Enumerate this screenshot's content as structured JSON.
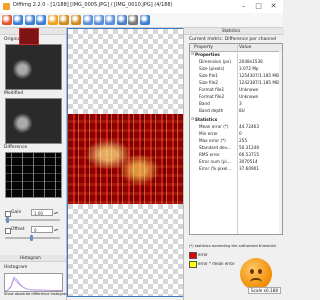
{
  "window": {
    "title": "Diffimg 2.2.0 - [1/188] [IMG_0005.JPG] / [IMG_0010.JPG] (4/188)",
    "controls": [
      "minimize",
      "maximize",
      "close"
    ]
  },
  "toolbar": {
    "buttons": [
      {
        "name": "open-icon",
        "color": "#e4572e"
      },
      {
        "name": "save-icon",
        "color": "#3b7ed3"
      },
      {
        "name": "previous-icon",
        "color": "#3b7ed3"
      },
      {
        "name": "next-icon",
        "color": "#3b7ed3"
      },
      {
        "name": "refresh-icon",
        "color": "#f0a020"
      },
      {
        "name": "flip-icon",
        "color": "#d08a20"
      },
      {
        "name": "layout-icon",
        "color": "#d08a20"
      },
      {
        "name": "zoom-fit-icon",
        "color": "#5a8ed8"
      },
      {
        "name": "zoom-in-icon",
        "color": "#5a8ed8"
      },
      {
        "name": "zoom-out-icon",
        "color": "#5a8ed8"
      },
      {
        "name": "select-icon",
        "color": "#4a7fc8"
      },
      {
        "name": "settings-icon",
        "color": "#777777"
      },
      {
        "name": "help-icon",
        "color": "#3b7ed3"
      }
    ]
  },
  "navigator": {
    "header": "Navigator",
    "original_label": "Original",
    "modified_label": "Modified",
    "difference_label": "Difference",
    "gain": {
      "label": "Gain",
      "value": "1.00"
    },
    "offset": {
      "label": "Offset",
      "value": "0"
    }
  },
  "histogram": {
    "header": "Histogram",
    "label": "Histogram",
    "note": "Show absolute difference histogram"
  },
  "statistics": {
    "header": "Statistics",
    "current_metric": "Current metric: Difference per channel",
    "columns": [
      "Property",
      "Value"
    ],
    "groups": [
      {
        "label": "Properties",
        "rows": [
          {
            "property": "Dimension (px)",
            "value": "2048x1536"
          },
          {
            "property": "Size (pixels)",
            "value": "3.072 Mp"
          },
          {
            "property": "Size file1",
            "value": "1254307/1.185 MB"
          },
          {
            "property": "Size file2",
            "value": "1242387/1.185 MB"
          },
          {
            "property": "Format file1",
            "value": "Unknown"
          },
          {
            "property": "Format file2",
            "value": "Unknown"
          },
          {
            "property": "Band",
            "value": "3"
          },
          {
            "property": "Band depth",
            "value": "8U"
          }
        ]
      },
      {
        "label": "Statistics",
        "rows": [
          {
            "property": "Mean error (*)",
            "value": "44.72463"
          },
          {
            "property": "Min error",
            "value": "0"
          },
          {
            "property": "Max error (*)",
            "value": "255"
          },
          {
            "property": "Standard dev...",
            "value": "50.31248"
          },
          {
            "property": "RMS error",
            "value": "66.53715"
          },
          {
            "property": "Error num (pi...",
            "value": "3070514"
          },
          {
            "property": "Error (% pixel...",
            "value": "37.60901"
          }
        ]
      }
    ],
    "threshold_note": "(*) statistics exceeding the authorized threshold",
    "legend": [
      {
        "label": "error",
        "color": "#e00000"
      },
      {
        "label": "error * mean error",
        "color": "#ffff00"
      }
    ],
    "scale": "Scale x0.188"
  }
}
